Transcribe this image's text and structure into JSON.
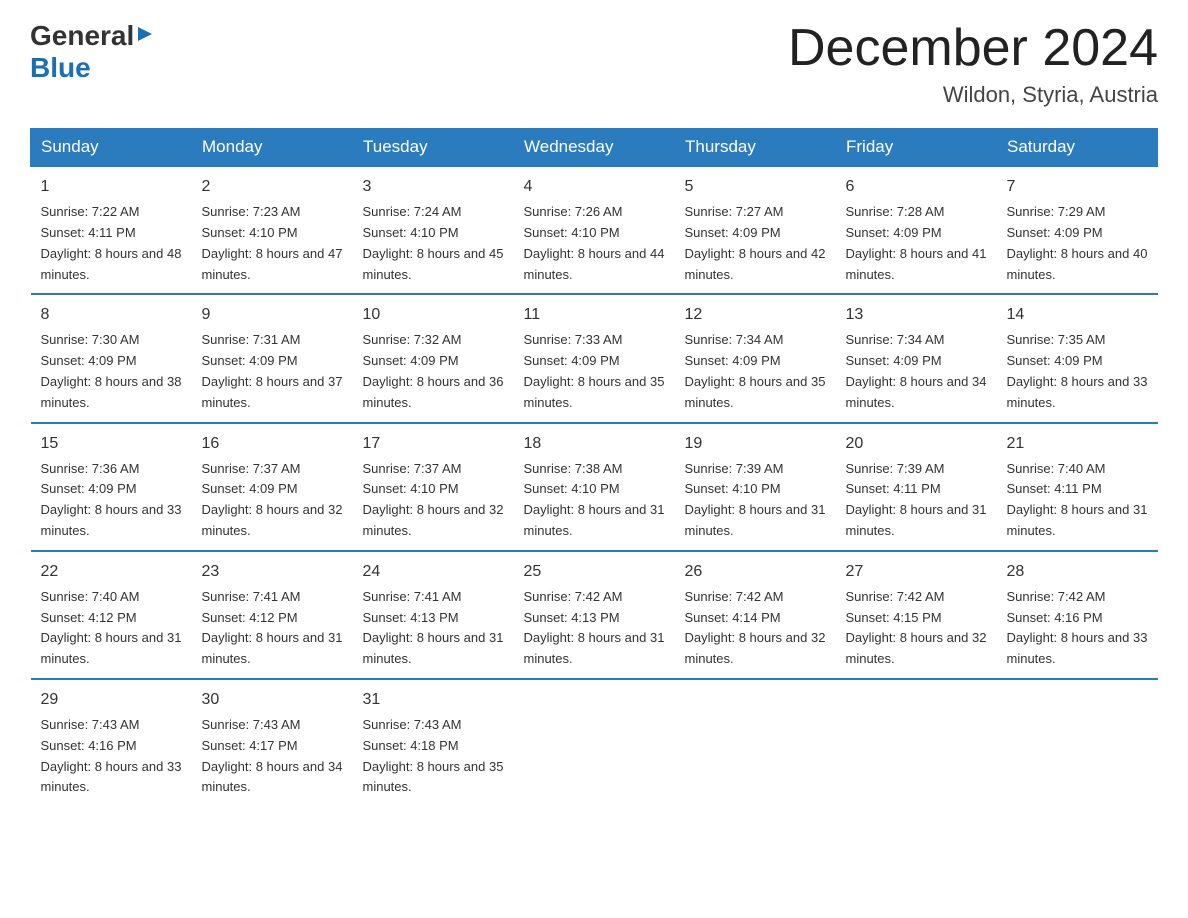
{
  "header": {
    "logo_general": "General",
    "logo_blue": "Blue",
    "month_title": "December 2024",
    "location": "Wildon, Styria, Austria"
  },
  "days_of_week": [
    "Sunday",
    "Monday",
    "Tuesday",
    "Wednesday",
    "Thursday",
    "Friday",
    "Saturday"
  ],
  "weeks": [
    [
      {
        "day": "1",
        "sunrise": "7:22 AM",
        "sunset": "4:11 PM",
        "daylight": "8 hours and 48 minutes."
      },
      {
        "day": "2",
        "sunrise": "7:23 AM",
        "sunset": "4:10 PM",
        "daylight": "8 hours and 47 minutes."
      },
      {
        "day": "3",
        "sunrise": "7:24 AM",
        "sunset": "4:10 PM",
        "daylight": "8 hours and 45 minutes."
      },
      {
        "day": "4",
        "sunrise": "7:26 AM",
        "sunset": "4:10 PM",
        "daylight": "8 hours and 44 minutes."
      },
      {
        "day": "5",
        "sunrise": "7:27 AM",
        "sunset": "4:09 PM",
        "daylight": "8 hours and 42 minutes."
      },
      {
        "day": "6",
        "sunrise": "7:28 AM",
        "sunset": "4:09 PM",
        "daylight": "8 hours and 41 minutes."
      },
      {
        "day": "7",
        "sunrise": "7:29 AM",
        "sunset": "4:09 PM",
        "daylight": "8 hours and 40 minutes."
      }
    ],
    [
      {
        "day": "8",
        "sunrise": "7:30 AM",
        "sunset": "4:09 PM",
        "daylight": "8 hours and 38 minutes."
      },
      {
        "day": "9",
        "sunrise": "7:31 AM",
        "sunset": "4:09 PM",
        "daylight": "8 hours and 37 minutes."
      },
      {
        "day": "10",
        "sunrise": "7:32 AM",
        "sunset": "4:09 PM",
        "daylight": "8 hours and 36 minutes."
      },
      {
        "day": "11",
        "sunrise": "7:33 AM",
        "sunset": "4:09 PM",
        "daylight": "8 hours and 35 minutes."
      },
      {
        "day": "12",
        "sunrise": "7:34 AM",
        "sunset": "4:09 PM",
        "daylight": "8 hours and 35 minutes."
      },
      {
        "day": "13",
        "sunrise": "7:34 AM",
        "sunset": "4:09 PM",
        "daylight": "8 hours and 34 minutes."
      },
      {
        "day": "14",
        "sunrise": "7:35 AM",
        "sunset": "4:09 PM",
        "daylight": "8 hours and 33 minutes."
      }
    ],
    [
      {
        "day": "15",
        "sunrise": "7:36 AM",
        "sunset": "4:09 PM",
        "daylight": "8 hours and 33 minutes."
      },
      {
        "day": "16",
        "sunrise": "7:37 AM",
        "sunset": "4:09 PM",
        "daylight": "8 hours and 32 minutes."
      },
      {
        "day": "17",
        "sunrise": "7:37 AM",
        "sunset": "4:10 PM",
        "daylight": "8 hours and 32 minutes."
      },
      {
        "day": "18",
        "sunrise": "7:38 AM",
        "sunset": "4:10 PM",
        "daylight": "8 hours and 31 minutes."
      },
      {
        "day": "19",
        "sunrise": "7:39 AM",
        "sunset": "4:10 PM",
        "daylight": "8 hours and 31 minutes."
      },
      {
        "day": "20",
        "sunrise": "7:39 AM",
        "sunset": "4:11 PM",
        "daylight": "8 hours and 31 minutes."
      },
      {
        "day": "21",
        "sunrise": "7:40 AM",
        "sunset": "4:11 PM",
        "daylight": "8 hours and 31 minutes."
      }
    ],
    [
      {
        "day": "22",
        "sunrise": "7:40 AM",
        "sunset": "4:12 PM",
        "daylight": "8 hours and 31 minutes."
      },
      {
        "day": "23",
        "sunrise": "7:41 AM",
        "sunset": "4:12 PM",
        "daylight": "8 hours and 31 minutes."
      },
      {
        "day": "24",
        "sunrise": "7:41 AM",
        "sunset": "4:13 PM",
        "daylight": "8 hours and 31 minutes."
      },
      {
        "day": "25",
        "sunrise": "7:42 AM",
        "sunset": "4:13 PM",
        "daylight": "8 hours and 31 minutes."
      },
      {
        "day": "26",
        "sunrise": "7:42 AM",
        "sunset": "4:14 PM",
        "daylight": "8 hours and 32 minutes."
      },
      {
        "day": "27",
        "sunrise": "7:42 AM",
        "sunset": "4:15 PM",
        "daylight": "8 hours and 32 minutes."
      },
      {
        "day": "28",
        "sunrise": "7:42 AM",
        "sunset": "4:16 PM",
        "daylight": "8 hours and 33 minutes."
      }
    ],
    [
      {
        "day": "29",
        "sunrise": "7:43 AM",
        "sunset": "4:16 PM",
        "daylight": "8 hours and 33 minutes."
      },
      {
        "day": "30",
        "sunrise": "7:43 AM",
        "sunset": "4:17 PM",
        "daylight": "8 hours and 34 minutes."
      },
      {
        "day": "31",
        "sunrise": "7:43 AM",
        "sunset": "4:18 PM",
        "daylight": "8 hours and 35 minutes."
      },
      null,
      null,
      null,
      null
    ]
  ]
}
